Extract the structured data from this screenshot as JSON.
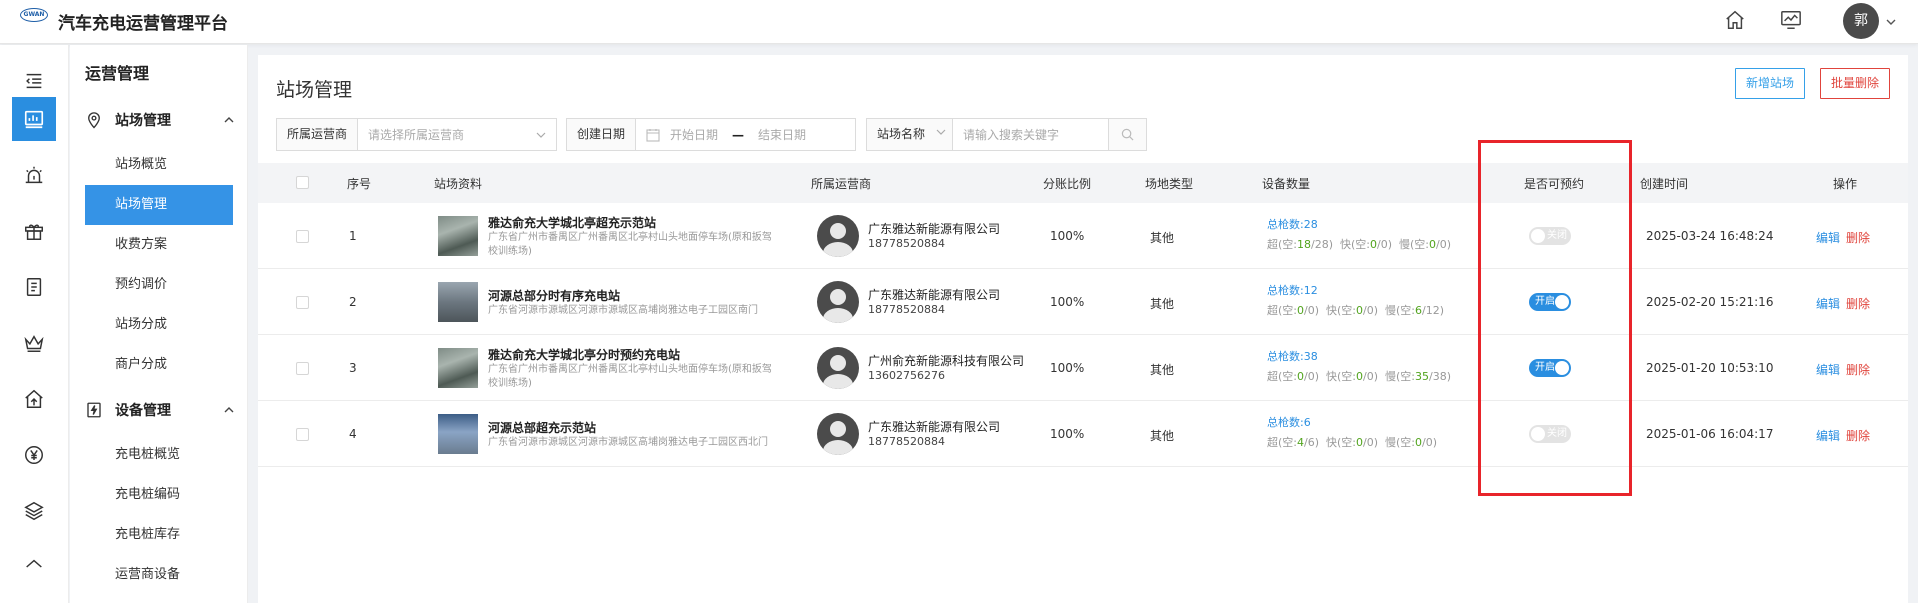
{
  "header": {
    "logo_text": "GWAN",
    "app_title": "汽车充电运营管理平台",
    "avatar_text": "郭",
    "icons": [
      "home-icon",
      "monitor-chart-icon"
    ]
  },
  "rail": {
    "items": [
      {
        "name": "collapse-menu-icon"
      },
      {
        "name": "dashboard-icon",
        "active": true
      },
      {
        "name": "alarm-icon"
      },
      {
        "name": "gift-icon"
      },
      {
        "name": "document-icon"
      },
      {
        "name": "crown-icon"
      },
      {
        "name": "house-up-icon"
      },
      {
        "name": "yuan-icon"
      },
      {
        "name": "layers-icon"
      },
      {
        "name": "more-icon"
      }
    ]
  },
  "submenu": {
    "title": "运营管理",
    "group1": {
      "label": "站场管理",
      "icon": "location-pin-icon"
    },
    "group1_items": [
      "站场概览",
      "站场管理",
      "收费方案",
      "预约调价",
      "站场分成",
      "商户分成"
    ],
    "group2": {
      "label": "设备管理",
      "icon": "charging-icon"
    },
    "group2_items": [
      "充电桩概览",
      "充电桩编码",
      "充电桩库存",
      "运营商设备"
    ]
  },
  "main": {
    "page_title": "站场管理",
    "btn_new": "新增站场",
    "btn_batch_delete": "批量删除",
    "filters": {
      "operator_label": "所属运营商",
      "operator_placeholder": "请选择所属运营商",
      "date_label": "创建日期",
      "date_start": "开始日期",
      "date_sep": "—",
      "date_end": "结束日期",
      "name_label": "站场名称",
      "search_placeholder": "请输入搜索关键字"
    },
    "table": {
      "headers": {
        "index": "序号",
        "station": "站场资料",
        "operator": "所属运营商",
        "ratio": "分账比例",
        "site_type": "场地类型",
        "devices": "设备数量",
        "reservable": "是否可预约",
        "created": "创建时间",
        "actions": "操作"
      },
      "rows": [
        {
          "index": "1",
          "name": "雅达俞充大学城北亭超充示范站",
          "addr1": "广东省广州市番禺区广州番禺区北亭村山头地面停车场(原和扳驾",
          "addr2": "校训练场)",
          "operator": "广东雅达新能源有限公司",
          "phone": "18778520884",
          "ratio": "100%",
          "site_type": "其他",
          "total": "总枪数:28",
          "super_label": "超(空:",
          "super_free": "18",
          "super_total": "/28)",
          "fast_label": "快(空:",
          "fast_free": "0",
          "fast_total": "/0)",
          "slow_label": "慢(空:",
          "slow_free": "0",
          "slow_total": "/0)",
          "reservable": false,
          "toggle_text": "关闭",
          "created": "2025-03-24 16:48:24",
          "edit": "编辑",
          "delete": "删除"
        },
        {
          "index": "2",
          "name": "河源总部分时有序充电站",
          "addr1": "广东省河源市源城区河源市源城区高埔岗雅达电子工园区南门",
          "addr2": "",
          "operator": "广东雅达新能源有限公司",
          "phone": "18778520884",
          "ratio": "100%",
          "site_type": "其他",
          "total": "总枪数:12",
          "super_label": "超(空:",
          "super_free": "0",
          "super_total": "/0)",
          "fast_label": "快(空:",
          "fast_free": "0",
          "fast_total": "/0)",
          "slow_label": "慢(空:",
          "slow_free": "6",
          "slow_total": "/12)",
          "reservable": true,
          "toggle_text": "开启",
          "created": "2025-02-20 15:21:16",
          "edit": "编辑",
          "delete": "删除"
        },
        {
          "index": "3",
          "name": "雅达俞充大学城北亭分时预约充电站",
          "addr1": "广东省广州市番禺区广州番禺区北亭村山头地面停车场(原和扳驾",
          "addr2": "校训练场)",
          "operator": "广州俞充新能源科技有限公司",
          "phone": "13602756276",
          "ratio": "100%",
          "site_type": "其他",
          "total": "总枪数:38",
          "super_label": "超(空:",
          "super_free": "0",
          "super_total": "/0)",
          "fast_label": "快(空:",
          "fast_free": "0",
          "fast_total": "/0)",
          "slow_label": "慢(空:",
          "slow_free": "35",
          "slow_total": "/38)",
          "reservable": true,
          "toggle_text": "开启",
          "created": "2025-01-20 10:53:10",
          "edit": "编辑",
          "delete": "删除"
        },
        {
          "index": "4",
          "name": "河源总部超充示范站",
          "addr1": "广东省河源市源城区河源市源城区高埔岗雅达电子工园区西北门",
          "addr2": "",
          "operator": "广东雅达新能源有限公司",
          "phone": "18778520884",
          "ratio": "100%",
          "site_type": "其他",
          "total": "总枪数:6",
          "super_label": "超(空:",
          "super_free": "4",
          "super_total": "/6)",
          "fast_label": "快(空:",
          "fast_free": "0",
          "fast_total": "/0)",
          "slow_label": "慢(空:",
          "slow_free": "0",
          "slow_total": "/0)",
          "reservable": false,
          "toggle_text": "关闭",
          "created": "2025-01-06 16:04:17",
          "edit": "编辑",
          "delete": "删除"
        }
      ]
    }
  },
  "colors": {
    "primary": "#2a8ee0",
    "danger": "#e0443c",
    "highlight": "#e8242a",
    "free_green": "#52a41e"
  }
}
